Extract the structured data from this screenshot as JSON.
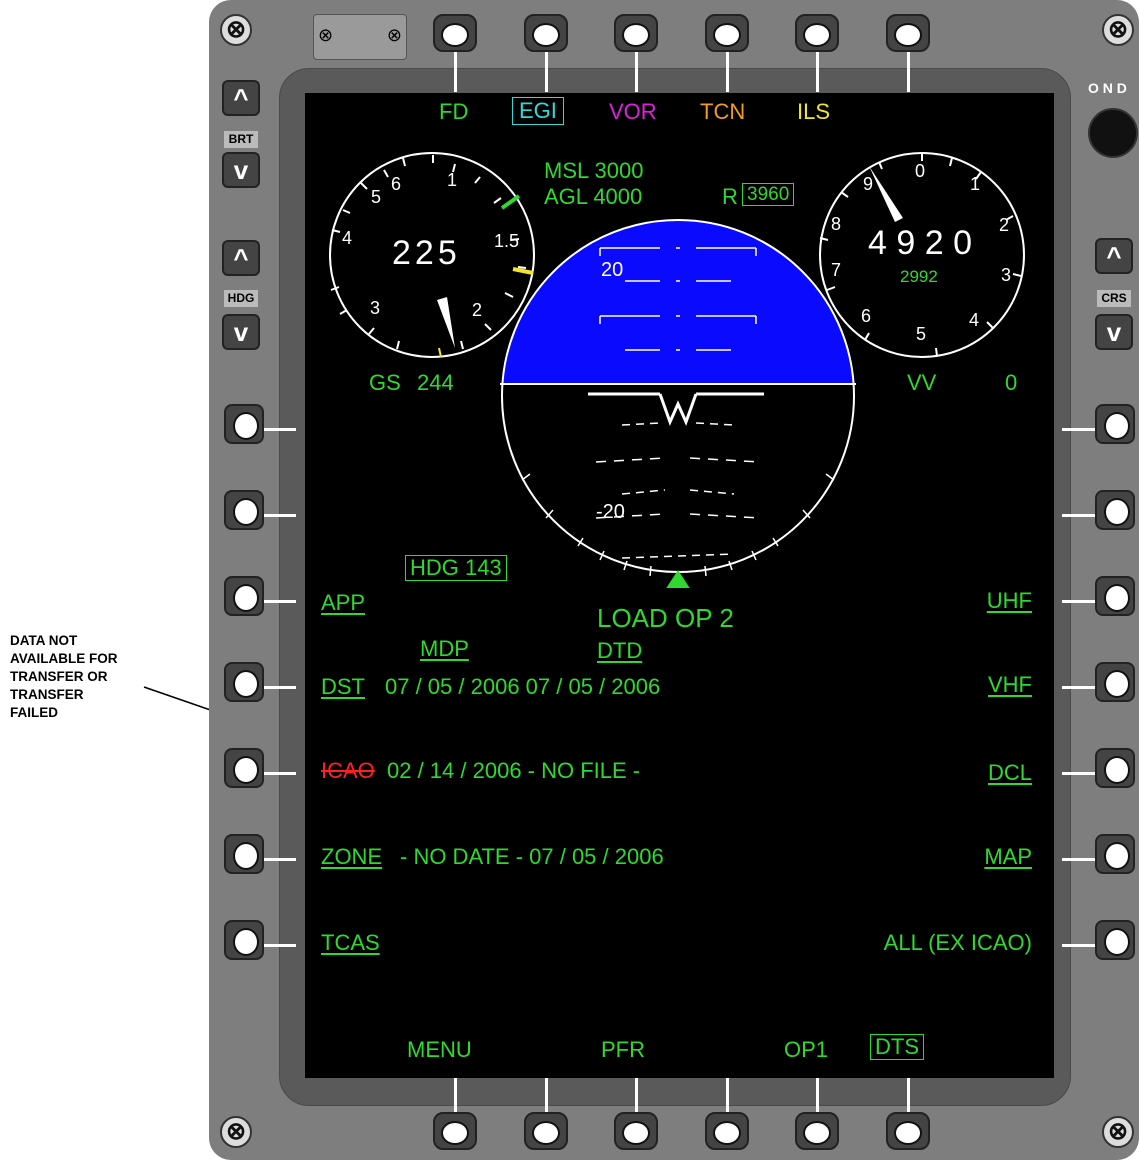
{
  "annotation": {
    "text_lines": [
      "DATA NOT",
      "AVAILABLE FOR",
      "TRANSFER OR",
      "TRANSFER",
      "FAILED"
    ]
  },
  "top_buttons": [
    {
      "label": "FD",
      "color": "#2fd92f"
    },
    {
      "label": "EGI",
      "color": "#2fd9d9"
    },
    {
      "label": "VOR",
      "color": "#e01fe0"
    },
    {
      "label": "TCN",
      "color": "#f29a22"
    },
    {
      "label": "ILS",
      "color": "#f2e52a"
    }
  ],
  "bezel_labels": {
    "brt": "BRT",
    "hdg": "HDG",
    "crs": "CRS",
    "knob": "O N D"
  },
  "airspeed": {
    "value": "225",
    "gs_label": "GS",
    "gs_value": "244",
    "scale": [
      "1",
      "1.5",
      "2",
      "3",
      "4",
      "5",
      "6"
    ]
  },
  "altitude": {
    "msl": "MSL 3000",
    "agl": "AGL 4000",
    "radar_label": "R",
    "radar_value": "3960"
  },
  "vsi": {
    "value": "4 9 2 0",
    "sub_value": "2992",
    "vv_label": "VV",
    "vv_value": "0",
    "scale": [
      "0",
      "1",
      "2",
      "3",
      "4",
      "5",
      "6",
      "7",
      "8",
      "9"
    ]
  },
  "adi": {
    "pitch_labels": [
      "20",
      "-20"
    ],
    "sky_color": "#0a0aff"
  },
  "heading": {
    "label": "HDG 143"
  },
  "status": {
    "load": "LOAD  OP 2",
    "mdp": "MDP",
    "dtd": "DTD"
  },
  "left_menu": [
    {
      "label": "APP",
      "values": ""
    },
    {
      "label": "DST",
      "values": "07 / 05 / 2006  07 / 05 / 2006"
    },
    {
      "label": "ICAO",
      "values": "02 / 14 / 2006  - NO FILE -",
      "error": true
    },
    {
      "label": "ZONE",
      "values": "- NO DATE -  07 / 05 / 2006"
    },
    {
      "label": "TCAS",
      "values": ""
    }
  ],
  "right_menu": [
    "UHF",
    "VHF",
    "DCL",
    "MAP",
    "ALL (EX  ICAO)"
  ],
  "bottom_menu": [
    "MENU",
    "PFR",
    "OP1",
    "DTS"
  ],
  "colors": {
    "green": "#2fd92f",
    "red": "#ff2020",
    "screen": "#000000",
    "bezel": "#7e7e7e"
  }
}
